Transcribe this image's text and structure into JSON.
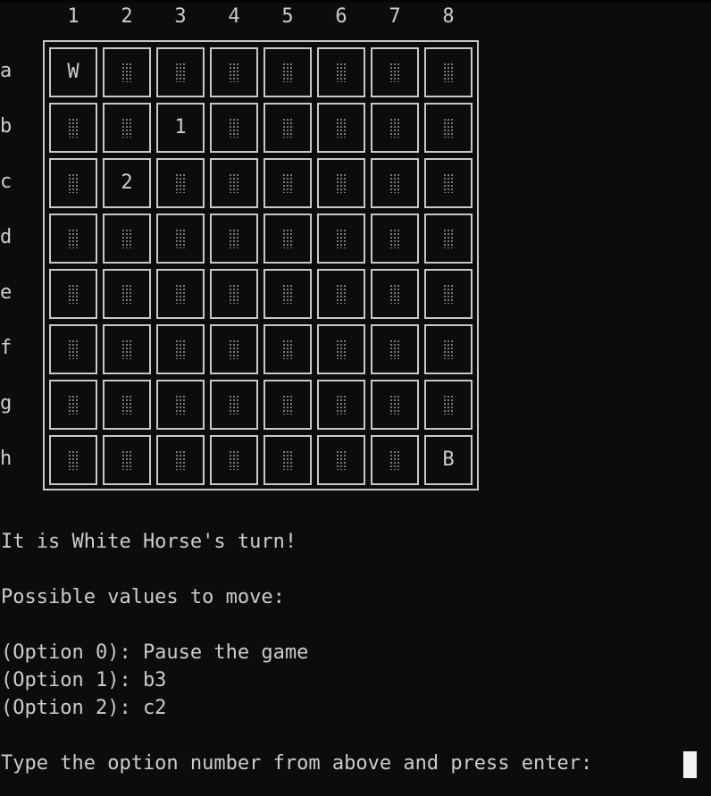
{
  "terminal": {
    "background": "#0c0c0c",
    "foreground": "#cccccc"
  },
  "board": {
    "column_labels": [
      "1",
      "2",
      "3",
      "4",
      "5",
      "6",
      "7",
      "8"
    ],
    "row_labels": [
      "a",
      "b",
      "c",
      "d",
      "e",
      "f",
      "g",
      "h"
    ],
    "empty_symbol": "shade-block",
    "cells": [
      [
        "W",
        "",
        "",
        "",
        "",
        "",
        "",
        ""
      ],
      [
        "",
        "",
        "1",
        "",
        "",
        "",
        "",
        ""
      ],
      [
        "",
        "2",
        "",
        "",
        "",
        "",
        "",
        ""
      ],
      [
        "",
        "",
        "",
        "",
        "",
        "",
        "",
        ""
      ],
      [
        "",
        "",
        "",
        "",
        "",
        "",
        "",
        ""
      ],
      [
        "",
        "",
        "",
        "",
        "",
        "",
        "",
        ""
      ],
      [
        "",
        "",
        "",
        "",
        "",
        "",
        "",
        ""
      ],
      [
        "",
        "",
        "",
        "",
        "",
        "",
        "",
        "B"
      ]
    ]
  },
  "messages": {
    "turn": "It is White Horse's turn!",
    "possible_header": "Possible values to move:",
    "options": [
      "(Option 0): Pause the game",
      "(Option 1): b3",
      "(Option 2): c2"
    ],
    "prompt": "Type the option number from above and press enter: "
  }
}
